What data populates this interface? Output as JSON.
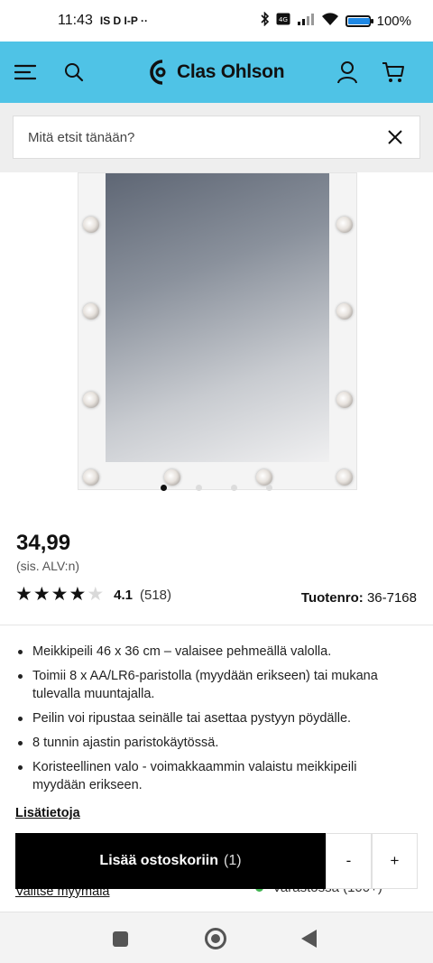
{
  "status_bar": {
    "time": "11:43",
    "notifications": "IS D I-P ··",
    "battery": "100%",
    "battery_level": 1.0
  },
  "header": {
    "brand": "Clas Ohlson",
    "menu_icon": "hamburger-menu-icon",
    "search_icon": "search-icon",
    "account_icon": "user-icon",
    "cart_icon": "shopping-cart-icon",
    "accent_color": "#4fc3e6"
  },
  "search": {
    "placeholder": "Mitä etsit tänään?",
    "clear_icon": "close-icon"
  },
  "gallery": {
    "image_count": 4,
    "active_index": 0
  },
  "product": {
    "price": "34,99",
    "vat_note": "(sis. ALV:n)",
    "rating": "4.1",
    "rating_stars": 4.1,
    "rating_count": "(518)",
    "sku_label": "Tuotenro:",
    "sku_value": "36-7168",
    "features": [
      "Meikkipeili 46 x 36 cm – valaisee pehmeällä valolla.",
      "Toimii 8 x AA/LR6-paristolla (myydään erikseen) tai mukana tulevalla muuntajalla.",
      "Peilin voi ripustaa seinälle tai asettaa pystyyn pöydälle.",
      "8 tunnin ajastin paristokäytössä.",
      "Koristeellinen valo - voimakkaammin valaistu meikkipeili myydään erikseen."
    ],
    "more_info": "Lisätietoja"
  },
  "store": {
    "choose_store": "Valitse myymälä",
    "stock_text": "Varastossa (100+)",
    "stock_color": "#3fb34f"
  },
  "cart": {
    "add_label": "Lisää ostoskoriin",
    "count": "(1)",
    "minus": "-",
    "plus": "+"
  }
}
